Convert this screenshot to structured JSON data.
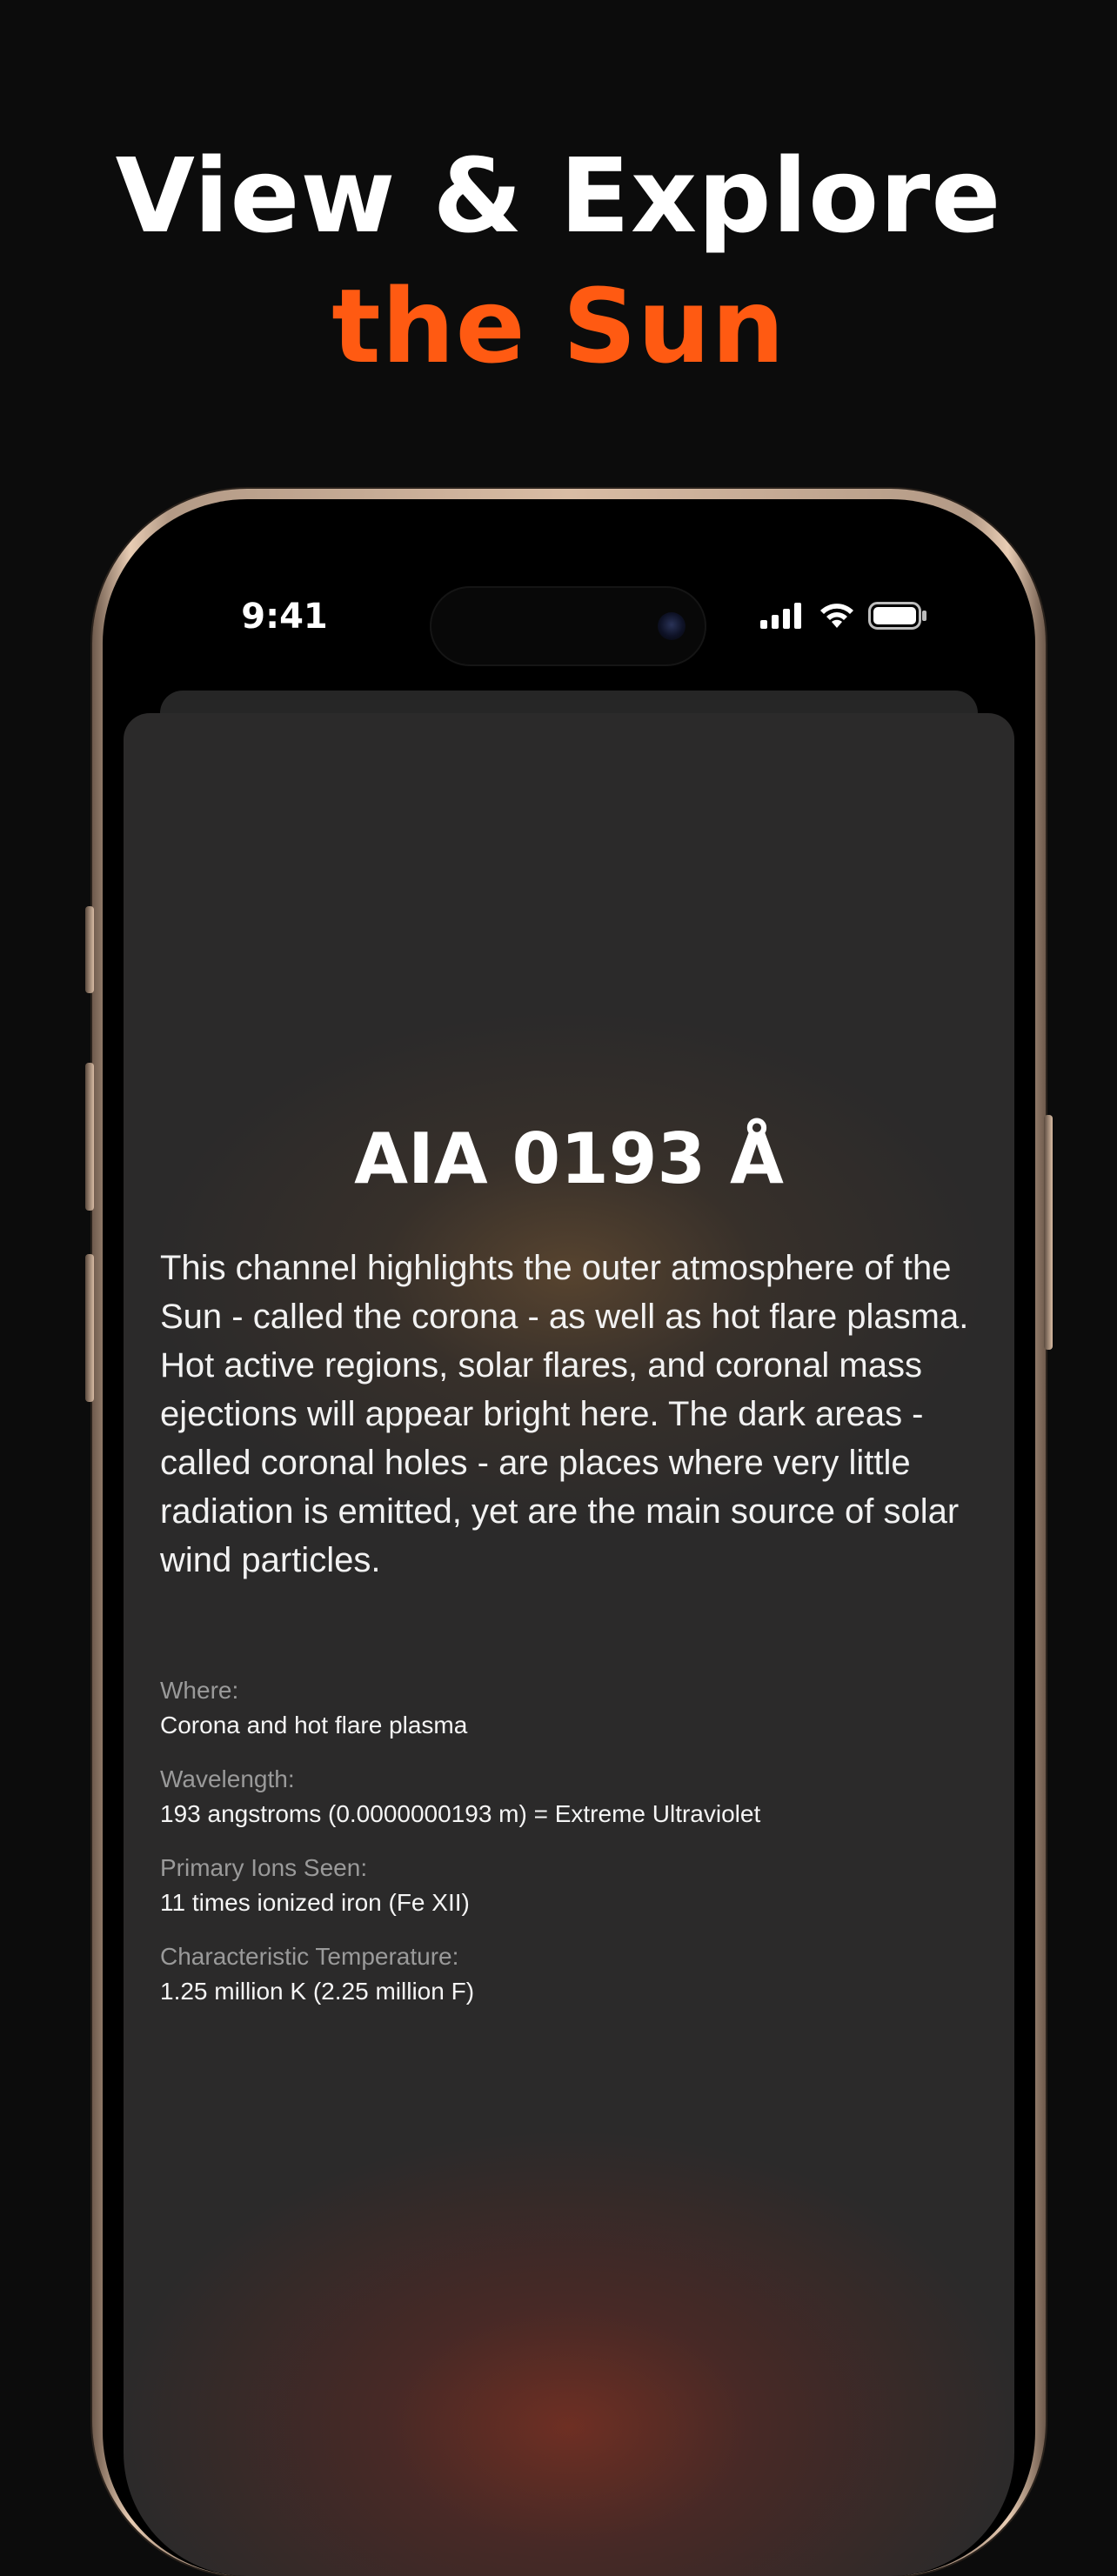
{
  "headline": {
    "line1": "View & Explore",
    "line2": "the Sun",
    "accent_color": "#ff5a12"
  },
  "status_bar": {
    "time": "9:41",
    "icons": [
      "cellular-signal-icon",
      "wifi-icon",
      "battery-icon"
    ]
  },
  "channel": {
    "title": "AIA 0193 Å",
    "description": "This channel highlights the outer atmosphere of the Sun - called the corona - as well as hot flare plasma. Hot active regions, solar flares, and coronal mass ejections will appear bright here. The dark areas - called coronal holes - are places where very little radiation is emitted, yet are the main source of solar wind particles.",
    "facts": [
      {
        "label": "Where:",
        "value": "Corona and hot flare plasma"
      },
      {
        "label": "Wavelength:",
        "value": "193 angstroms (0.0000000193 m) = Extreme Ultraviolet"
      },
      {
        "label": "Primary Ions Seen:",
        "value": "11 times ionized iron (Fe XII)"
      },
      {
        "label": "Characteristic Temperature:",
        "value": "1.25 million K (2.25 million F)"
      }
    ]
  }
}
